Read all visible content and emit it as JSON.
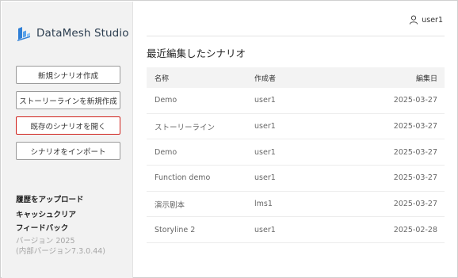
{
  "app": {
    "title": "DataMesh Studio"
  },
  "header": {
    "username": "user1"
  },
  "sidebar": {
    "buttons": [
      {
        "label": "新規シナリオ作成"
      },
      {
        "label": "ストーリーラインを新規作成"
      },
      {
        "label": "既存のシナリオを開く"
      },
      {
        "label": "シナリオをインポート"
      }
    ],
    "links": [
      {
        "label": "履歴をアップロード"
      },
      {
        "label": "キャッシュクリア"
      },
      {
        "label": "フィードバック"
      }
    ],
    "version": "バージョン 2025",
    "internal_version": "(内部バージョン7.3.0.44)"
  },
  "main": {
    "title": "最近編集したシナリオ",
    "columns": {
      "name": "名称",
      "creator": "作成者",
      "date": "編集日"
    },
    "rows": [
      {
        "name": "Demo",
        "creator": "user1",
        "date": "2025-03-27"
      },
      {
        "name": "ストーリーライン",
        "creator": "user1",
        "date": "2025-03-27"
      },
      {
        "name": "Demo",
        "creator": "user1",
        "date": "2025-03-27"
      },
      {
        "name": "Function demo",
        "creator": "user1",
        "date": "2025-03-27"
      },
      {
        "name": "演示剧本",
        "creator": "lms1",
        "date": "2025-03-27"
      },
      {
        "name": "Storyline 2",
        "creator": "user1",
        "date": "2025-02-28"
      }
    ]
  },
  "colors": {
    "active_border": "#d0211c",
    "logo_blue": "#2f7fd6"
  }
}
